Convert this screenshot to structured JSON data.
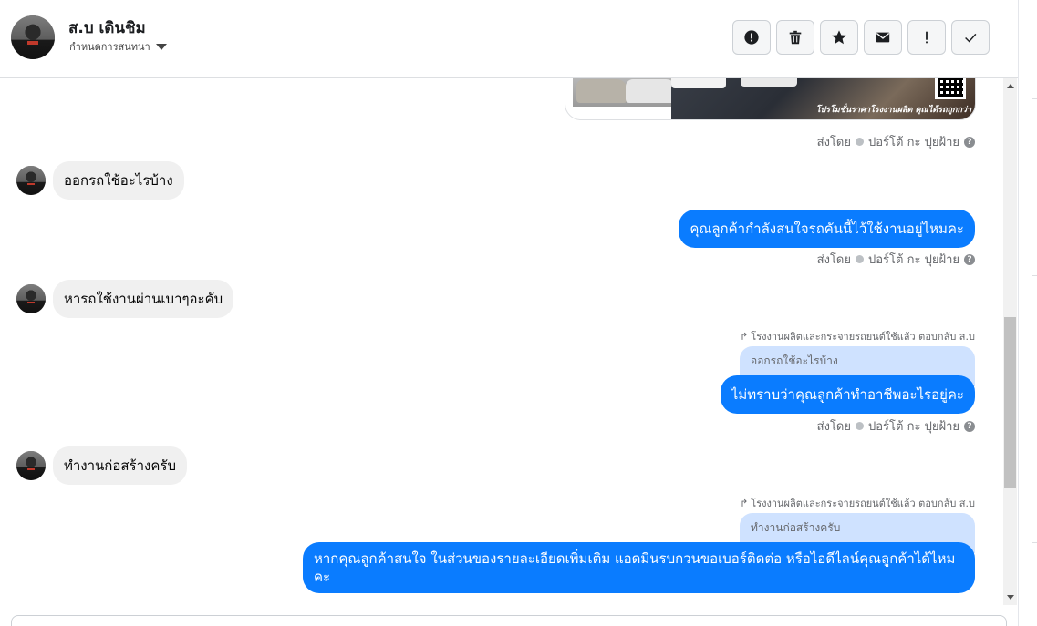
{
  "header": {
    "contact_name": "ส.บ เดินชิม",
    "subtitle": "กำหนดการสนทนา"
  },
  "toolbar": {
    "buttons": [
      {
        "name": "spam-button",
        "icon": "alert-circle-icon"
      },
      {
        "name": "delete-button",
        "icon": "trash-icon"
      },
      {
        "name": "star-button",
        "icon": "star-icon"
      },
      {
        "name": "mark-unread-button",
        "icon": "envelope-icon"
      },
      {
        "name": "follow-up-button",
        "icon": "exclamation-icon"
      },
      {
        "name": "done-button",
        "icon": "check-icon"
      }
    ]
  },
  "image_card": {
    "caption": "โปรโมชั่นราคาโรงงานผลิต คุณได้รถถูกกว่า"
  },
  "sent_by": {
    "prefix": "ส่งโดย",
    "name": "ปอร์โต้ กะ ปุยฝ้าย",
    "help": "?"
  },
  "messages": {
    "m1_in": "ออกรถใช้อะไรบ้าง",
    "m2_out": "คุณลูกค้ากำลังสนใจรถคันนี้ไว้ใช้งานอยู่ไหมคะ",
    "m3_in": "หารถใช้งานผ่านเบาๆอะคับ",
    "m4_reply_label": "โรงงานผลิตและกระจายรถยนต์ใช้แล้ว ตอบกลับ ส.บ",
    "m4_quote": "ออกรถใช้อะไรบ้าง",
    "m4_out": "ไม่ทราบว่าคุณลูกค้าทำอาชีพอะไรอยู่คะ",
    "m5_in": "ทำงานก่อสร้างครับ",
    "m6_reply_label": "โรงงานผลิตและกระจายรถยนต์ใช้แล้ว ตอบกลับ ส.บ",
    "m6_quote": "ทำงานก่อสร้างครับ",
    "m6_out": "หากคุณลูกค้าสนใจ ในส่วนของรายละเอียดเพิ่มเติม แอดมินรบกวนขอเบอร์ติดต่อ หรือไอดีไลน์คุณลูกค้าได้ไหมคะ"
  },
  "colors": {
    "outgoing_bubble": "#0a7cff",
    "incoming_bubble": "#f0f0f0",
    "quoted_bubble": "#cfe2ff"
  }
}
